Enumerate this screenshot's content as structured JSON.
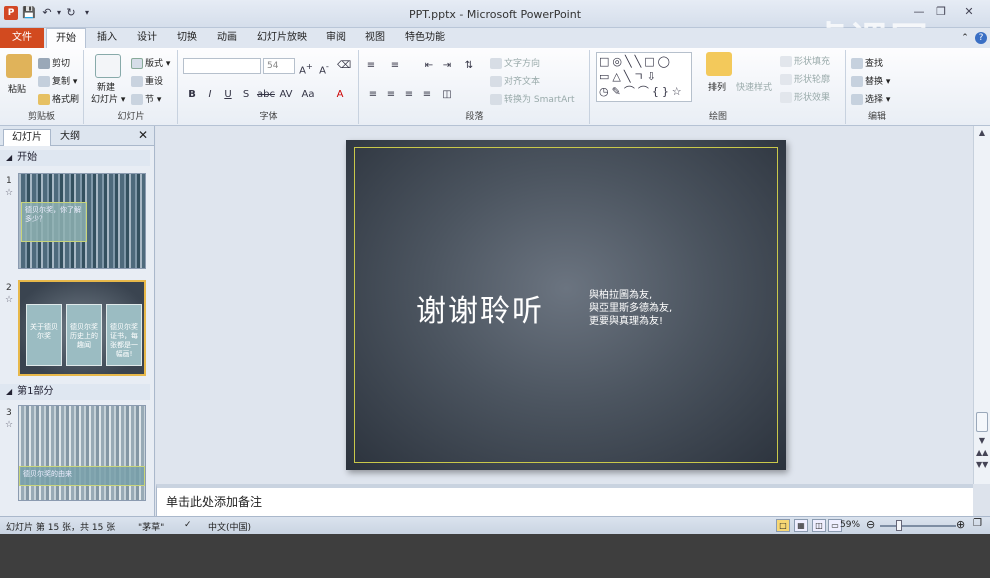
{
  "window": {
    "app_icon_letter": "P",
    "title": "PPT.pptx - Microsoft PowerPoint",
    "watermark": "虎课网"
  },
  "tabs": [
    "文件",
    "开始",
    "插入",
    "设计",
    "切换",
    "动画",
    "幻灯片放映",
    "审阅",
    "视图",
    "特色功能"
  ],
  "ribbon": {
    "clipboard": {
      "paste": "粘贴",
      "cut": "剪切",
      "copy": "复制",
      "format_painter": "格式刷",
      "label": "剪贴板"
    },
    "slides": {
      "new_slide_line1": "新建",
      "new_slide_line2": "幻灯片",
      "layout": "版式",
      "reset": "重设",
      "section": "节",
      "label": "幻灯片"
    },
    "font": {
      "size": "54",
      "label": "字体"
    },
    "paragraph": {
      "text_direction": "文字方向",
      "align_text": "对齐文本",
      "smartart": "转换为 SmartArt",
      "label": "段落"
    },
    "drawing": {
      "shapes": "□◎╲╲□◯ ▭△╲ㄱ⇩ ◷✎⌒⌒{}☆",
      "arrange": "排列",
      "quick_styles": "快速样式",
      "shape_fill": "形状填充",
      "shape_outline": "形状轮廓",
      "shape_effects": "形状效果",
      "label": "绘图"
    },
    "editing": {
      "find": "查找",
      "replace": "替换",
      "select": "选择",
      "label": "编辑"
    }
  },
  "slide_pane": {
    "tab_slides": "幻灯片",
    "tab_outline": "大纲",
    "sections": [
      "开始",
      "第1部分"
    ],
    "slides": [
      {
        "num": "1",
        "caption": "德贝尔奖，你了解多少？"
      },
      {
        "num": "2",
        "title": "",
        "cards": [
          "关于德贝尔奖",
          "德贝尔奖历史上的趣闻",
          "德贝尔奖证书，每张都是一幅画!"
        ]
      },
      {
        "num": "3",
        "caption": "德贝尔奖的由来"
      }
    ]
  },
  "slide": {
    "title": "谢谢聆听",
    "quote_lines": [
      "與柏拉圖為友,",
      "與亞里斯多德為友,",
      "更要與真理為友!"
    ]
  },
  "notes": {
    "placeholder": "单击此处添加备注"
  },
  "status": {
    "slide_info": "幻灯片 第 15 张，共 15 张",
    "theme": "\"茅草\"",
    "language": "中文(中国)",
    "zoom": "59%"
  }
}
